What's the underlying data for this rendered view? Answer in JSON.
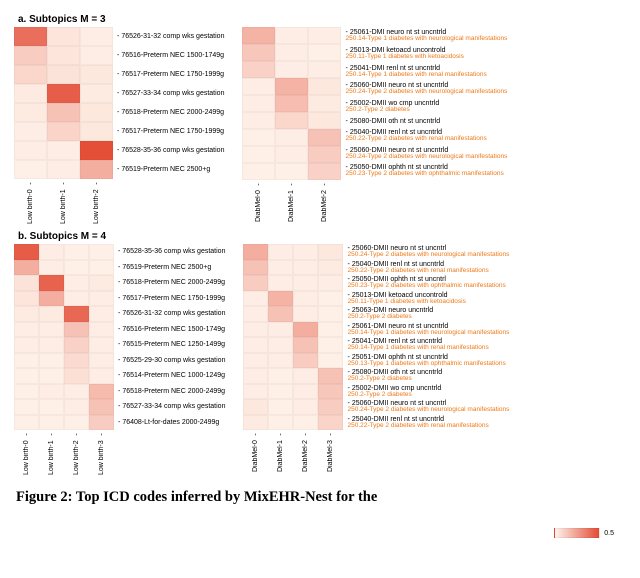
{
  "panel_a_label": "a. Subtopics M = 3",
  "panel_b_label": "b. Subtopics M = 4",
  "caption": "Figure 2: Top ICD codes inferred by MixEHR-Nest for the",
  "color_scale": {
    "min": 0.02,
    "max": 0.7,
    "low_color": "#fff4ec",
    "high_color": "#e34a33"
  },
  "legend_ticks": [
    "0.5"
  ],
  "chart_data": [
    {
      "id": "a_left",
      "type": "heatmap",
      "title": "Subtopics M = 3 — Low birth",
      "x": [
        "Low birth-0",
        "Low birth-1",
        "Low birth-2"
      ],
      "y": [
        {
          "label": "76526-31-32 comp wks gestation"
        },
        {
          "label": "76516-Preterm NEC 1500-1749g"
        },
        {
          "label": "76517-Preterm NEC 1750-1999g"
        },
        {
          "label": "76527-33-34 comp wks gestation"
        },
        {
          "label": "76518-Preterm NEC 2000-2499g"
        },
        {
          "label": "76517-Preterm NEC 1750-1999g"
        },
        {
          "label": "76528-35-36 comp wks gestation"
        },
        {
          "label": "76519-Preterm NEC 2500+g"
        }
      ],
      "values": [
        [
          0.55,
          0.08,
          0.05
        ],
        [
          0.18,
          0.08,
          0.05
        ],
        [
          0.14,
          0.09,
          0.07
        ],
        [
          0.06,
          0.62,
          0.06
        ],
        [
          0.06,
          0.22,
          0.07
        ],
        [
          0.05,
          0.15,
          0.07
        ],
        [
          0.05,
          0.05,
          0.68
        ],
        [
          0.04,
          0.05,
          0.3
        ]
      ]
    },
    {
      "id": "a_right",
      "type": "heatmap",
      "title": "Subtopics M = 3 — DiabMel",
      "x": [
        "DiabMel-0",
        "DiabMel-1",
        "DiabMel-2"
      ],
      "y": [
        {
          "label": "25061-DMI neuro nt st uncntrld",
          "sublabel": "250.14-Type 1 diabetes with neurological manifestations"
        },
        {
          "label": "25013-DMI ketoacd uncontrold",
          "sublabel": "250.11-Type 1 diabetes with ketoacidosis"
        },
        {
          "label": "25041-DMI renl nt st uncntrld",
          "sublabel": "250.14-Type 1 diabetes with renal manifestations"
        },
        {
          "label": "25060-DMII neuro nt st uncntrld",
          "sublabel": "250.24-Type 2 diabetes with neurological manifestations"
        },
        {
          "label": "25002-DMII wo cmp uncntrld",
          "sublabel": "250.2-Type 2 diabetes"
        },
        {
          "label": "25080-DMII oth nt st uncntrld"
        },
        {
          "label": "25040-DMII renl nt st uncntrld",
          "sublabel": "250.22-Type 2 diabetes with renal manifestations"
        },
        {
          "label": "25060-DMII neuro nt st uncntrld",
          "sublabel": "250.24-Type 2 diabetes with neurological manifestations"
        },
        {
          "label": "25050-DMII ophth nt st uncntrld",
          "sublabel": "250.23-Type 2 diabetes with ophthalmic manifestations"
        }
      ],
      "values": [
        [
          0.28,
          0.05,
          0.05
        ],
        [
          0.2,
          0.05,
          0.04
        ],
        [
          0.16,
          0.05,
          0.05
        ],
        [
          0.05,
          0.28,
          0.07
        ],
        [
          0.05,
          0.24,
          0.06
        ],
        [
          0.05,
          0.14,
          0.07
        ],
        [
          0.04,
          0.05,
          0.22
        ],
        [
          0.04,
          0.05,
          0.18
        ],
        [
          0.04,
          0.04,
          0.16
        ]
      ]
    },
    {
      "id": "b_left",
      "type": "heatmap",
      "title": "Subtopics M = 4 — Low birth",
      "x": [
        "Low birth-0",
        "Low birth-1",
        "Low birth-2",
        "Low birth-3"
      ],
      "y": [
        {
          "label": "76528-35-36 comp wks gestation"
        },
        {
          "label": "76519-Preterm NEC 2500+g"
        },
        {
          "label": "76518-Preterm NEC 2000-2499g"
        },
        {
          "label": "76517-Preterm NEC 1750-1999g"
        },
        {
          "label": "76526-31-32 comp wks gestation"
        },
        {
          "label": "76516-Preterm NEC 1500-1749g"
        },
        {
          "label": "76515-Preterm NEC 1250-1499g"
        },
        {
          "label": "76525-29-30 comp wks gestation"
        },
        {
          "label": "76514-Preterm NEC 1000-1249g"
        },
        {
          "label": "76518-Preterm NEC 2000-2499g"
        },
        {
          "label": "76527-33-34 comp wks gestation"
        },
        {
          "label": "76408-Lt-for-dates 2000-2499g"
        }
      ],
      "values": [
        [
          0.63,
          0.05,
          0.04,
          0.04
        ],
        [
          0.3,
          0.05,
          0.04,
          0.04
        ],
        [
          0.09,
          0.6,
          0.05,
          0.06
        ],
        [
          0.08,
          0.3,
          0.05,
          0.05
        ],
        [
          0.06,
          0.06,
          0.58,
          0.05
        ],
        [
          0.05,
          0.05,
          0.22,
          0.05
        ],
        [
          0.05,
          0.05,
          0.16,
          0.05
        ],
        [
          0.04,
          0.04,
          0.12,
          0.05
        ],
        [
          0.04,
          0.04,
          0.1,
          0.05
        ],
        [
          0.04,
          0.05,
          0.05,
          0.25
        ],
        [
          0.04,
          0.04,
          0.05,
          0.22
        ],
        [
          0.04,
          0.04,
          0.04,
          0.18
        ]
      ]
    },
    {
      "id": "b_right",
      "type": "heatmap",
      "title": "Subtopics M = 4 — DiabMel",
      "x": [
        "DiabMel-0",
        "DiabMel-1",
        "DiabMel-2",
        "DiabMel-3"
      ],
      "y": [
        {
          "label": "25060-DMII neuro nt st uncntrl",
          "sublabel": "250.24-Type 2 diabetes with neurological manifestations"
        },
        {
          "label": "25040-DMII renl nt st uncntrld",
          "sublabel": "250.22-Type 2 diabetes with renal manifestations"
        },
        {
          "label": "25050-DMII ophth nt st uncntrl",
          "sublabel": "250.23-Type 2 diabetes with ophthalmic manifestations"
        },
        {
          "label": "25013-DMI ketoacd uncontrold",
          "sublabel": "250.11-Type 1 diabetes with ketoacidosis"
        },
        {
          "label": "25063-DMI neuro uncntrld",
          "sublabel": "250.2-Type 2 diabetes"
        },
        {
          "label": "25061-DMI neuro nt st uncntrld",
          "sublabel": "250.14-Type 1 diabetes with neurological manifestations"
        },
        {
          "label": "25041-DMI renl nt st uncntrld",
          "sublabel": "250.14-Type 1 diabetes with renal manifestations"
        },
        {
          "label": "25051-DMI ophth nt st uncntrld",
          "sublabel": "250.13-Type 1 diabetes with ophthalmic manifestations"
        },
        {
          "label": "25080-DMII oth nt st uncntrld",
          "sublabel": "250.2-Type 2 diabetes"
        },
        {
          "label": "25002-DMII wo cmp uncntrld",
          "sublabel": "250.2-Type 2 diabetes"
        },
        {
          "label": "25060-DMII neuro nt st uncntrl",
          "sublabel": "250.24-Type 2 diabetes with neurological manifestations"
        },
        {
          "label": "25040-DMII renl nt st uncntrld",
          "sublabel": "250.22-Type 2 diabetes with renal manifestations"
        }
      ],
      "values": [
        [
          0.3,
          0.05,
          0.05,
          0.07
        ],
        [
          0.22,
          0.05,
          0.05,
          0.06
        ],
        [
          0.18,
          0.05,
          0.05,
          0.05
        ],
        [
          0.05,
          0.28,
          0.05,
          0.04
        ],
        [
          0.05,
          0.22,
          0.05,
          0.04
        ],
        [
          0.05,
          0.05,
          0.3,
          0.04
        ],
        [
          0.05,
          0.05,
          0.22,
          0.04
        ],
        [
          0.05,
          0.05,
          0.18,
          0.04
        ],
        [
          0.05,
          0.04,
          0.05,
          0.22
        ],
        [
          0.05,
          0.04,
          0.05,
          0.2
        ],
        [
          0.07,
          0.04,
          0.05,
          0.18
        ],
        [
          0.06,
          0.04,
          0.04,
          0.15
        ]
      ]
    }
  ]
}
